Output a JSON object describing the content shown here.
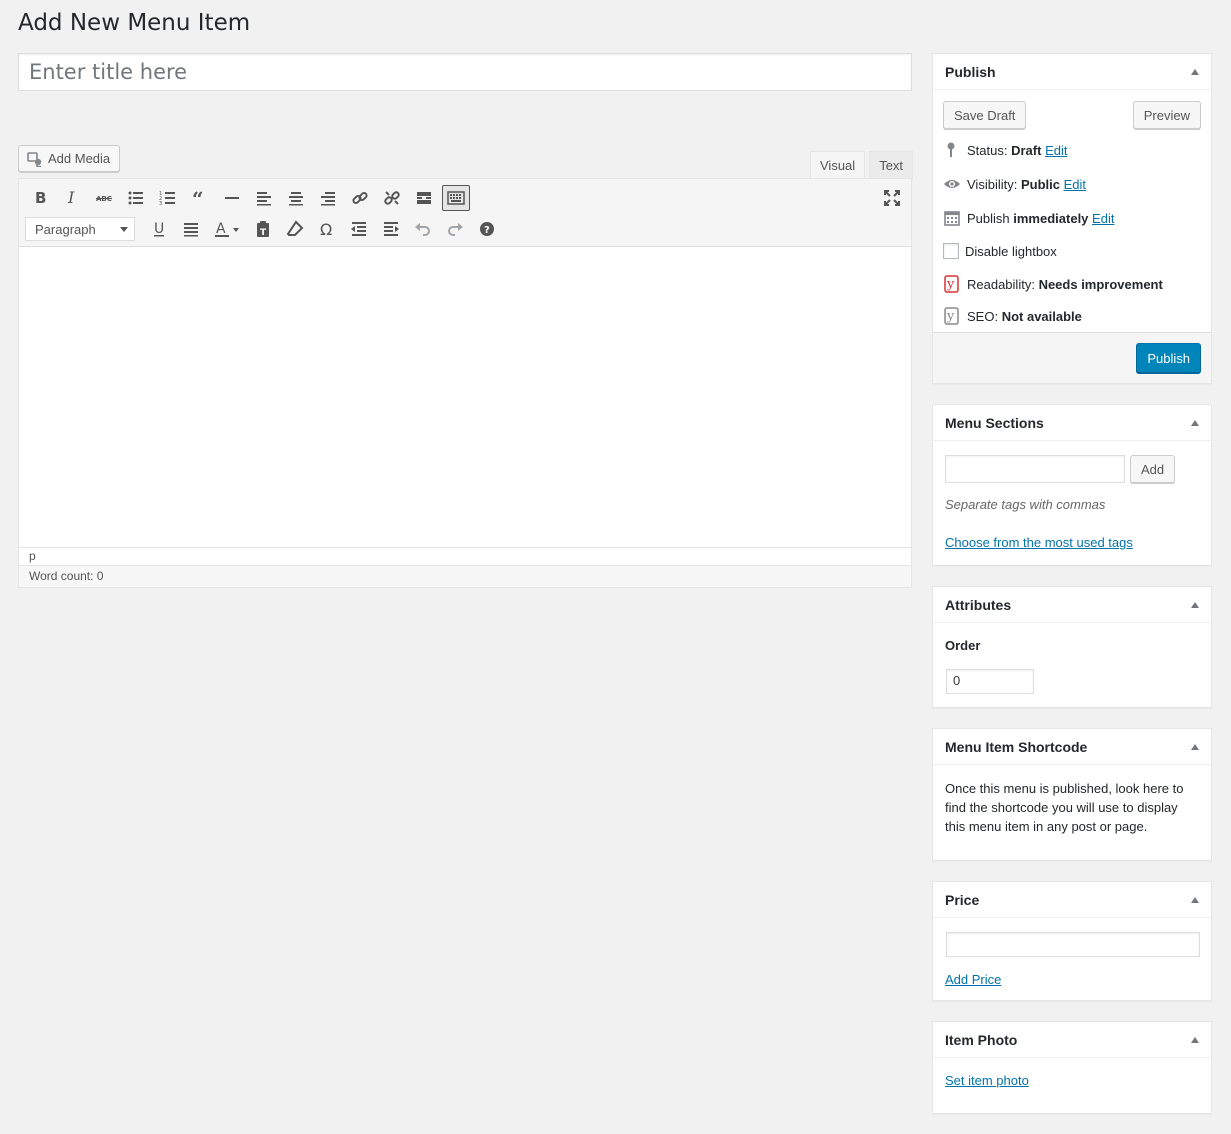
{
  "page": {
    "title": "Add New Menu Item"
  },
  "title_field": {
    "placeholder": "Enter title here"
  },
  "editor": {
    "add_media_label": "Add Media",
    "tabs": [
      {
        "label": "Visual",
        "active": true
      },
      {
        "label": "Text",
        "active": false
      }
    ],
    "format_select": "Paragraph",
    "path": "p",
    "word_count": "Word count: 0",
    "toolbar_icons_row1": [
      "bold-icon",
      "italic-icon",
      "strikethrough-icon",
      "bullet-list-icon",
      "numbered-list-icon",
      "blockquote-icon",
      "horizontal-rule-icon",
      "align-left-icon",
      "align-center-icon",
      "align-right-icon",
      "link-icon",
      "unlink-icon",
      "read-more-icon",
      "toolbar-toggle-icon"
    ],
    "toolbar_icons_row2": [
      "underline-icon",
      "justify-icon",
      "text-color-icon",
      "paste-text-icon",
      "clear-formatting-icon",
      "special-character-icon",
      "outdent-icon",
      "indent-icon",
      "undo-icon",
      "redo-icon",
      "help-icon"
    ]
  },
  "publish": {
    "title": "Publish",
    "save_draft": "Save Draft",
    "preview": "Preview",
    "status_label": "Status:",
    "status_value": "Draft",
    "visibility_label": "Visibility:",
    "visibility_value": "Public",
    "publish_label": "Publish",
    "publish_value": "immediately",
    "edit": "Edit",
    "disable_lightbox": "Disable lightbox",
    "readability_label": "Readability:",
    "readability_value": "Needs improvement",
    "seo_label": "SEO:",
    "seo_value": "Not available",
    "publish_button": "Publish"
  },
  "menu_sections": {
    "title": "Menu Sections",
    "add_button": "Add",
    "hint": "Separate tags with commas",
    "choose_link": "Choose from the most used tags"
  },
  "attributes": {
    "title": "Attributes",
    "order_label": "Order",
    "order_value": "0"
  },
  "shortcode": {
    "title": "Menu Item Shortcode",
    "text": "Once this menu is published, look here to find the shortcode you will use to display this menu item in any post or page."
  },
  "price": {
    "title": "Price",
    "add_link": "Add Price"
  },
  "item_photo": {
    "title": "Item Photo",
    "set_link": "Set item photo"
  },
  "colors": {
    "link": "#0073aa",
    "primary_button": "#0085ba",
    "readability_bad": "#dc3232",
    "background": "#f1f1f1"
  }
}
